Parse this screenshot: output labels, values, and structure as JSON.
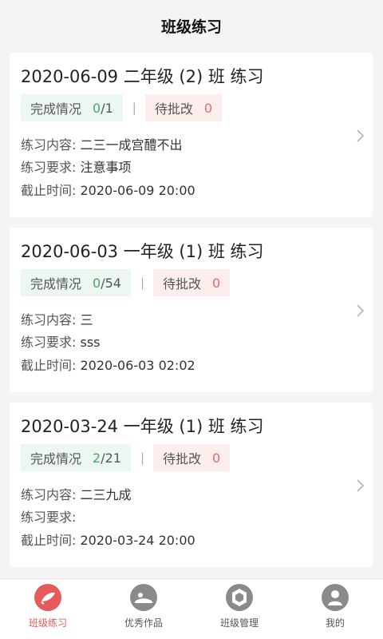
{
  "header": {
    "title": "班级练习"
  },
  "cards": [
    {
      "title": "2020-06-09 二年级 (2) 班 练习",
      "done_label": "完成情况",
      "done_count": "0",
      "done_total": "/1",
      "pending_label": "待批改",
      "pending_count": "0",
      "content_key": "练习内容:",
      "content_val": "二三一成宫醴不出",
      "req_key": "练习要求:",
      "req_val": "注意事项",
      "deadline_key": "截止时间:",
      "deadline_val": "2020-06-09 20:00"
    },
    {
      "title": "2020-06-03 一年级 (1) 班 练习",
      "done_label": "完成情况",
      "done_count": "0",
      "done_total": "/54",
      "pending_label": "待批改",
      "pending_count": "0",
      "content_key": "练习内容:",
      "content_val": "三",
      "req_key": "练习要求:",
      "req_val": "sss",
      "deadline_key": "截止时间:",
      "deadline_val": "2020-06-03 02:02"
    },
    {
      "title": "2020-03-24 一年级 (1) 班 练习",
      "done_label": "完成情况",
      "done_count": "2",
      "done_total": "/21",
      "pending_label": "待批改",
      "pending_count": "0",
      "content_key": "练习内容:",
      "content_val": "二三九成",
      "req_key": "练习要求:",
      "req_val": "",
      "deadline_key": "截止时间:",
      "deadline_val": "2020-03-24 20:00"
    }
  ],
  "divider": "|",
  "tabbar": {
    "items": [
      {
        "label": "班级练习",
        "icon": "class-practice-icon",
        "active": true
      },
      {
        "label": "优秀作品",
        "icon": "excellent-works-icon",
        "active": false
      },
      {
        "label": "班级管理",
        "icon": "class-management-icon",
        "active": false
      },
      {
        "label": "我的",
        "icon": "profile-icon",
        "active": false
      }
    ]
  },
  "colors": {
    "accent": "#e55a5a",
    "green": "#4aa472",
    "icon_gray": "#8a8a8a"
  }
}
